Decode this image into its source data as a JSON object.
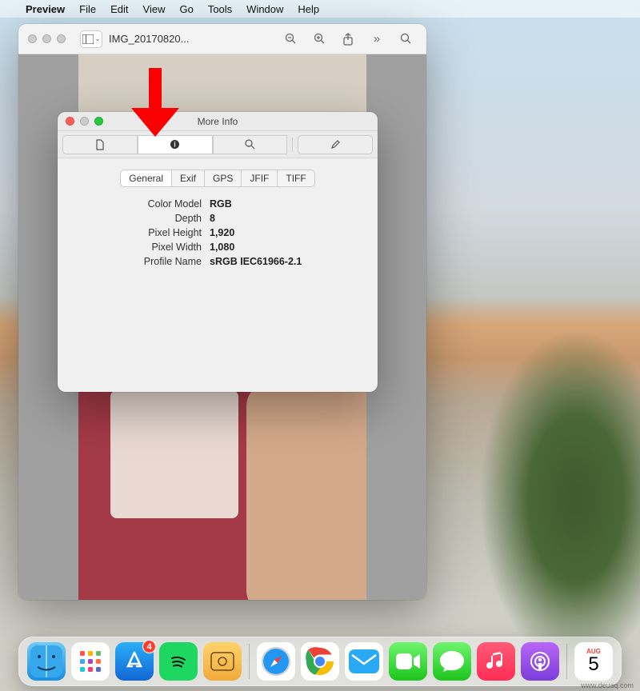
{
  "menubar": {
    "app": "Preview",
    "items": [
      "File",
      "Edit",
      "View",
      "Go",
      "Tools",
      "Window",
      "Help"
    ]
  },
  "preview_window": {
    "title": "IMG_20170820..."
  },
  "info_window": {
    "title": "More Info",
    "subtabs": [
      "General",
      "Exif",
      "GPS",
      "JFIF",
      "TIFF"
    ],
    "active_subtab": "General",
    "rows": {
      "color_model": {
        "label": "Color Model",
        "value": "RGB"
      },
      "depth": {
        "label": "Depth",
        "value": "8"
      },
      "pixel_height": {
        "label": "Pixel Height",
        "value": "1,920"
      },
      "pixel_width": {
        "label": "Pixel Width",
        "value": "1,080"
      },
      "profile_name": {
        "label": "Profile Name",
        "value": "sRGB IEC61966-2.1"
      }
    }
  },
  "dock": {
    "appstore_badge": "4",
    "calendar": {
      "month": "AUG",
      "day": "5"
    }
  },
  "watermark": "www.deuaq.com"
}
